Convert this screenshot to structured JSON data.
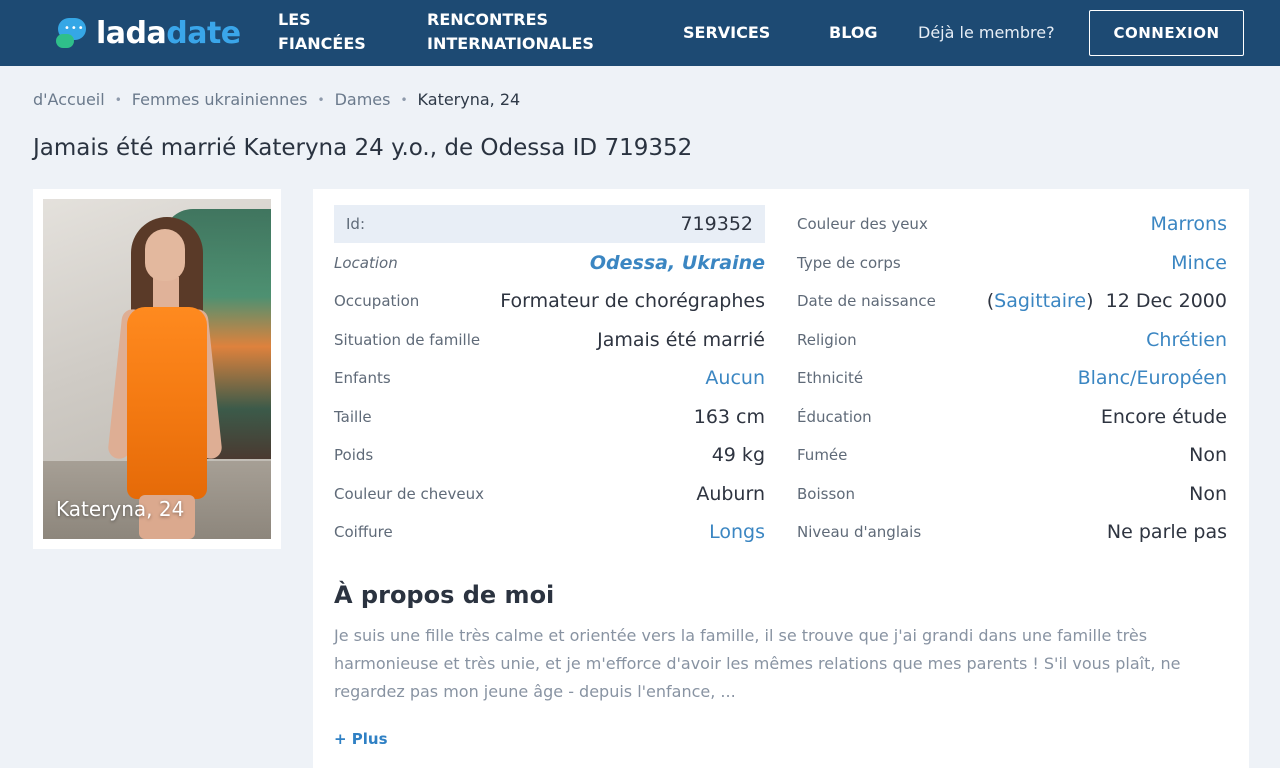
{
  "header": {
    "logo": {
      "part1": "lada",
      "part2": "date"
    },
    "nav": [
      {
        "line1": "Les",
        "line2": "fiancées"
      },
      {
        "line1": "Rencontres",
        "line2": "internationales"
      },
      {
        "label": "Services"
      },
      {
        "label": "Blog"
      }
    ],
    "member_text": "Déjà le membre?",
    "login_label": "CONNEXION"
  },
  "breadcrumb": [
    "d'Accueil",
    "Femmes ukrainiennes",
    "Dames",
    "Kateryna, 24"
  ],
  "page_title": "Jamais été marrié Kateryna 24 y.o., de Odessa ID 719352",
  "photo": {
    "caption": "Kateryna, 24"
  },
  "profile_left": [
    {
      "label": "Id:",
      "value": "719352"
    },
    {
      "label": "Location",
      "value": "Odessa, Ukraine"
    },
    {
      "label": "Occupation",
      "value": "Formateur de chorégraphes"
    },
    {
      "label": "Situation de famille",
      "value": "Jamais été marrié"
    },
    {
      "label": "Enfants",
      "value": "Aucun"
    },
    {
      "label": "Taille",
      "value": "163 cm"
    },
    {
      "label": "Poids",
      "value": "49 kg"
    },
    {
      "label": "Couleur de cheveux",
      "value": "Auburn"
    },
    {
      "label": "Coiffure",
      "value": "Longs"
    }
  ],
  "profile_right": [
    {
      "label": "Couleur des yeux",
      "value": "Marrons"
    },
    {
      "label": "Type de corps",
      "value": "Mince"
    },
    {
      "label": "Date de naissance",
      "zodiac": "Sagittaire",
      "value": "12 Dec 2000"
    },
    {
      "label": "Religion",
      "value": "Chrétien"
    },
    {
      "label": "Ethnicité",
      "value": "Blanc/Européen"
    },
    {
      "label": "Éducation",
      "value": "Encore étude"
    },
    {
      "label": "Fumée",
      "value": "Non"
    },
    {
      "label": "Boisson",
      "value": "Non"
    },
    {
      "label": "Niveau d'anglais",
      "value": "Ne parle pas"
    }
  ],
  "about": {
    "title": "À propos de moi",
    "text": "Je suis une fille très calme et orientée vers la famille, il se trouve que j'ai grandi dans une famille très harmonieuse et très unie, et je m'efforce d'avoir les mêmes relations que mes parents ! S'il vous plaît, ne regardez pas mon jeune âge - depuis l'enfance, ...",
    "more_label": "+ Plus"
  },
  "colors": {
    "header_bg": "#1d4a73",
    "link": "#3b86c2",
    "page_bg": "#eef2f7"
  }
}
